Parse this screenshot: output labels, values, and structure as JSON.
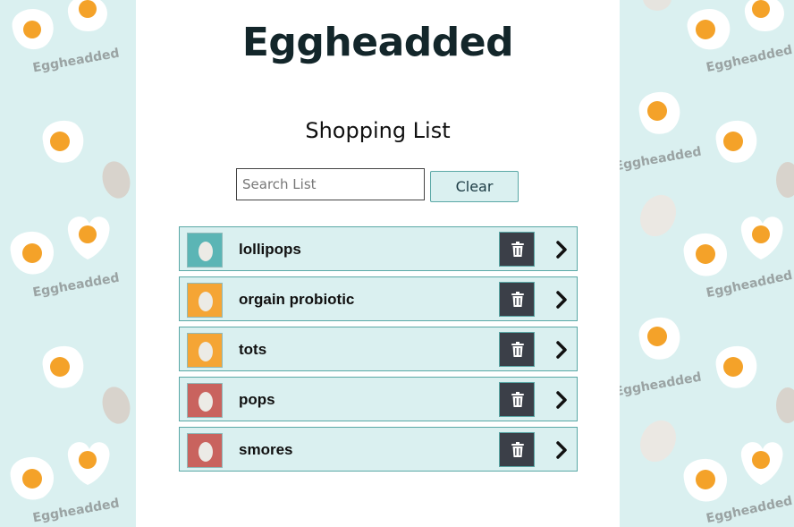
{
  "brand": {
    "title": "Eggheadded",
    "watermark": "Eggheadded"
  },
  "list": {
    "title": "Shopping List"
  },
  "search": {
    "placeholder": "Search List",
    "value": ""
  },
  "buttons": {
    "clear_label": "Clear"
  },
  "items": [
    {
      "label": "lollipops",
      "color": "#5bb5b5"
    },
    {
      "label": "orgain probiotic",
      "color": "#f5a535"
    },
    {
      "label": "tots",
      "color": "#f5a535"
    },
    {
      "label": "pops",
      "color": "#c9635e"
    },
    {
      "label": "smores",
      "color": "#c9635e"
    }
  ],
  "icons": {
    "item": "egg-icon",
    "delete": "trash-icon",
    "open": "chevron-right-icon"
  }
}
